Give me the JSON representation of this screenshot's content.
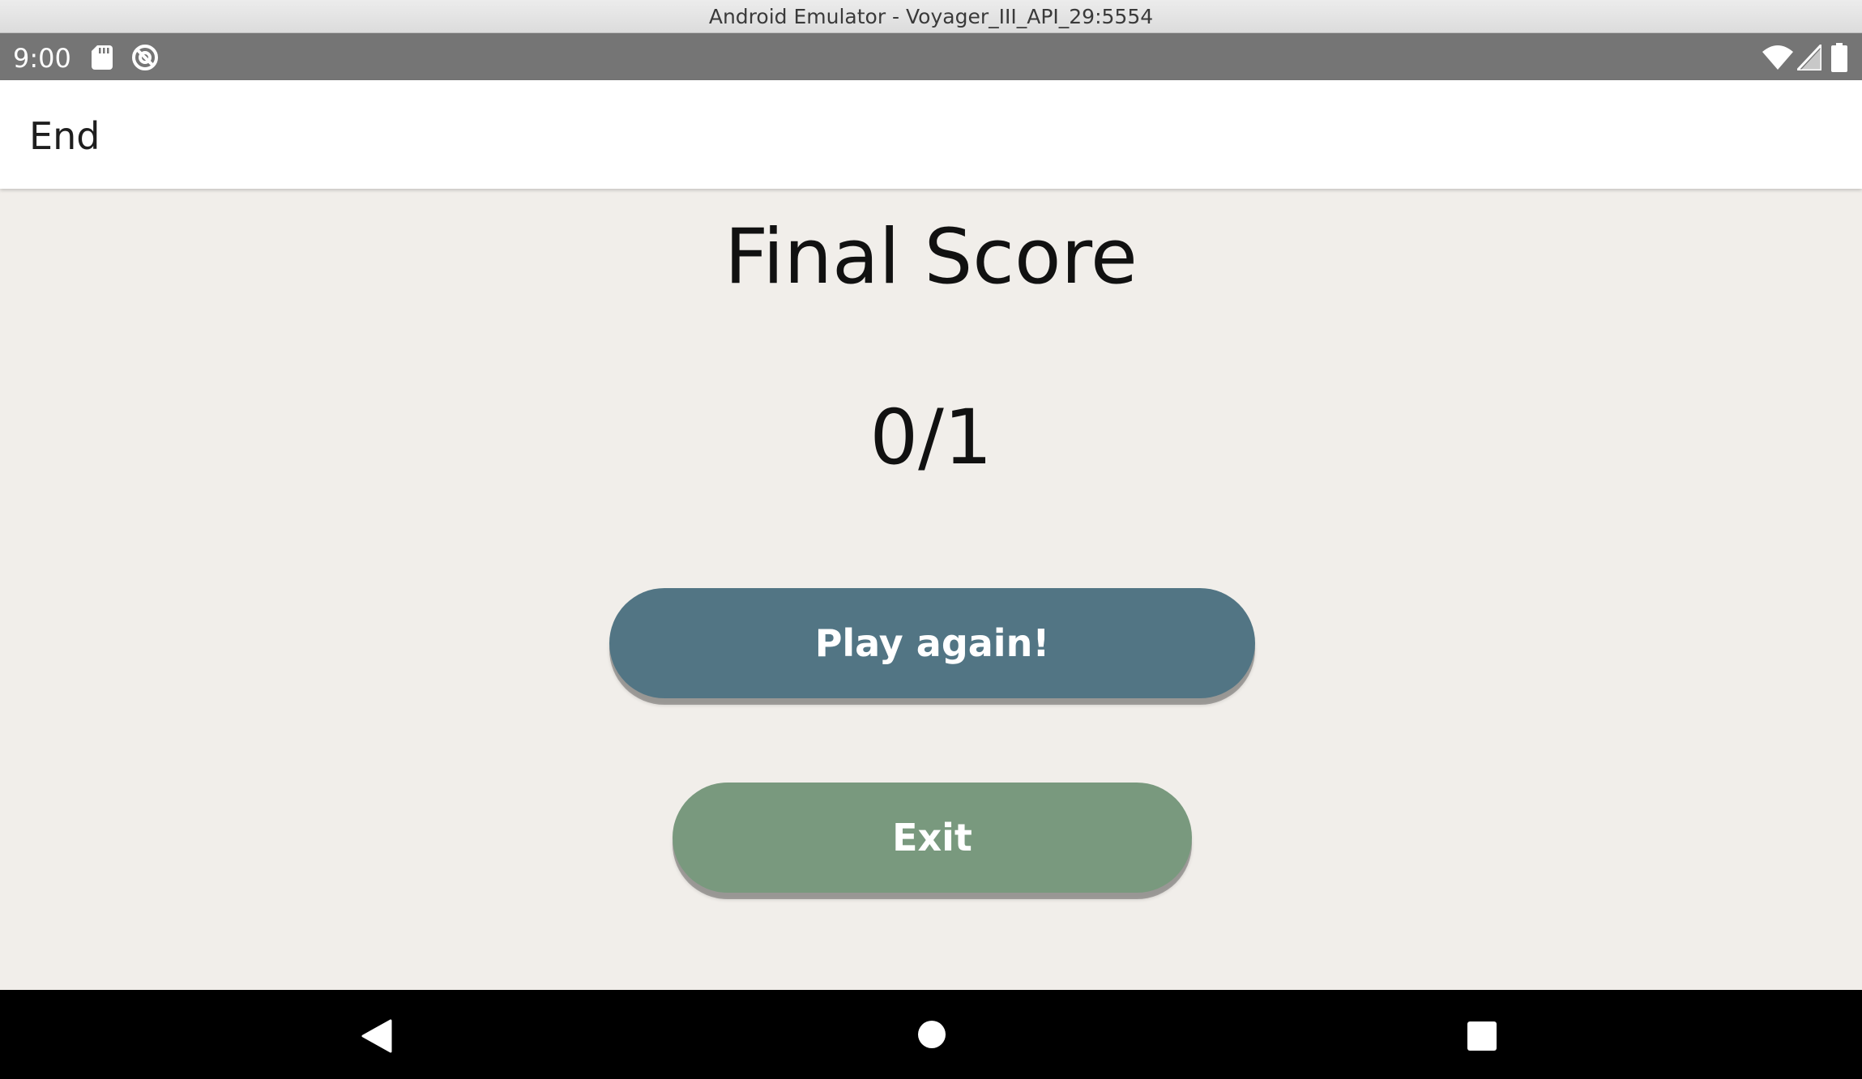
{
  "window": {
    "title": "Android Emulator - Voyager_III_API_29:5554"
  },
  "status_bar": {
    "time": "9:00",
    "icons": [
      "sd-card-icon",
      "sync-icon",
      "wifi-icon",
      "signal-icon",
      "battery-icon"
    ]
  },
  "app_bar": {
    "title": "End"
  },
  "main": {
    "heading": "Final Score",
    "score": "0/1",
    "play_again_label": "Play again!",
    "exit_label": "Exit"
  },
  "nav_bar": {
    "icons": [
      "back-icon",
      "home-icon",
      "recents-icon"
    ]
  },
  "colors": {
    "status_bar": "#757575",
    "app_bar": "#ffffff",
    "background": "#f1eeea",
    "play_again_button": "#527584",
    "exit_button": "#79997e",
    "nav_bar": "#000000"
  }
}
